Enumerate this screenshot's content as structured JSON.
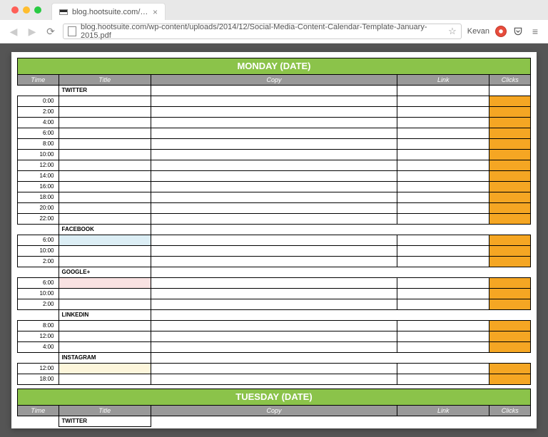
{
  "browser": {
    "tab_title": "blog.hootsuite.com/wp-co",
    "url": "blog.hootsuite.com/wp-content/uploads/2014/12/Social-Media-Content-Calendar-Template-January-2015.pdf",
    "profile_name": "Kevan"
  },
  "columns": {
    "time": "Time",
    "title": "Title",
    "copy": "Copy",
    "link": "Link",
    "clicks": "Clicks"
  },
  "days": {
    "monday": "MONDAY (DATE)",
    "tuesday": "TUESDAY (DATE)"
  },
  "networks": {
    "twitter": "TWITTER",
    "facebook": "FACEBOOK",
    "googleplus": "GOOGLE+",
    "linkedin": "LINKEDIN",
    "instagram": "INSTAGRAM"
  },
  "times": {
    "twitter": [
      "0:00",
      "2:00",
      "4:00",
      "6:00",
      "8:00",
      "10:00",
      "12:00",
      "14:00",
      "16:00",
      "18:00",
      "20:00",
      "22:00"
    ],
    "facebook": [
      "6:00",
      "10:00",
      "2:00"
    ],
    "googleplus": [
      "6:00",
      "10:00",
      "2:00"
    ],
    "linkedin": [
      "8:00",
      "12:00",
      "4:00"
    ],
    "instagram": [
      "12:00",
      "18:00"
    ]
  }
}
